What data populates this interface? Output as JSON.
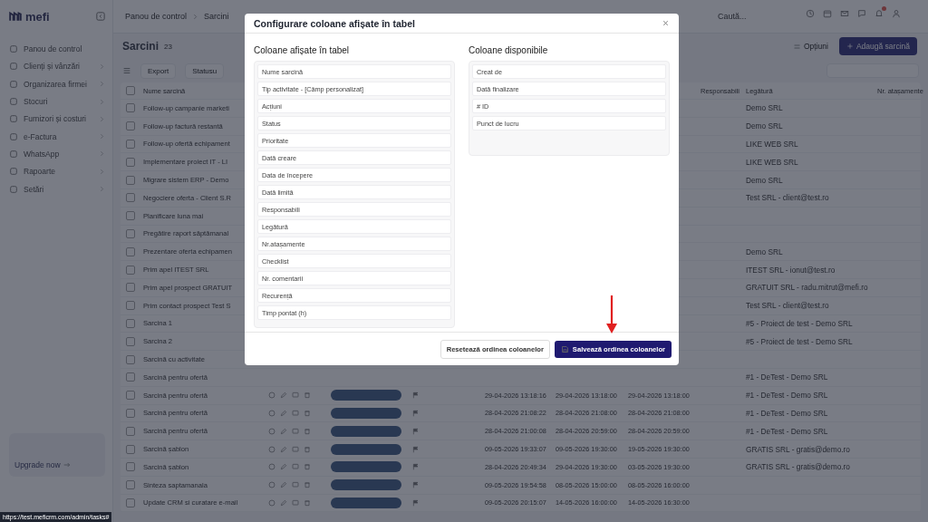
{
  "app": {
    "logo": "mefi",
    "breadcrumb": [
      "Panou de control",
      "Sarcini"
    ],
    "search": {
      "placeholder": "Caută..."
    }
  },
  "sidebar": {
    "items": [
      {
        "label": "Panou de control",
        "submenu": false
      },
      {
        "label": "Clienți și vânzări",
        "submenu": true
      },
      {
        "label": "Organizarea firmei",
        "submenu": true
      },
      {
        "label": "Stocuri",
        "submenu": true
      },
      {
        "label": "Furnizori și costuri",
        "submenu": true
      },
      {
        "label": "e-Factura",
        "submenu": true
      },
      {
        "label": "WhatsApp",
        "submenu": true
      },
      {
        "label": "Rapoarte",
        "submenu": true
      },
      {
        "label": "Setări",
        "submenu": true
      }
    ],
    "upgrade": "Upgrade now"
  },
  "page": {
    "title": "Sarcini",
    "count": "23",
    "options_button": "Opțiuni",
    "add_button": "Adaugă sarcină",
    "toolbar": [
      "Export",
      "Statusu"
    ]
  },
  "table": {
    "columns": [
      "Nume sarcină",
      "Responsabili",
      "Legătură",
      "Nr. atașamente"
    ],
    "select_all_checked": false,
    "rows": [
      {
        "name": "Follow-up campanie marketi",
        "checked": false,
        "link": "Demo SRL"
      },
      {
        "name": "Follow-up factură restantă",
        "checked": false,
        "link": "Demo SRL"
      },
      {
        "name": "Follow-up ofertă echipament",
        "checked": false,
        "link": "LIKE WEB SRL"
      },
      {
        "name": "Implementare proiect IT - LI",
        "checked": false,
        "link": "LIKE WEB SRL"
      },
      {
        "name": "Migrare sistem ERP - Demo",
        "checked": false,
        "link": "Demo SRL"
      },
      {
        "name": "Negociere oferta - Client S.R",
        "checked": false,
        "link": "Test SRL - client@test.ro"
      },
      {
        "name": "Planificare luna mai",
        "checked": false
      },
      {
        "name": "Pregătire raport săptămanal",
        "checked": false
      },
      {
        "name": "Prezentare oferta echipamen",
        "checked": false,
        "link": "Demo SRL"
      },
      {
        "name": "Prim apel ITEST SRL",
        "checked": false,
        "link": "ITEST SRL - ionut@test.ro"
      },
      {
        "name": "Prim apel prospect GRATUIT",
        "checked": false,
        "link": "GRATUIT SRL - radu.mitrut@mefi.ro"
      },
      {
        "name": "Prim contact prospect Test S",
        "checked": false,
        "link": "Test SRL - client@test.ro"
      },
      {
        "name": "Sarcina 1",
        "checked": false,
        "link": "#5 - Proiect de test - Demo SRL"
      },
      {
        "name": "Sarcina 2",
        "checked": false,
        "link": "#5 - Proiect de test - Demo SRL"
      },
      {
        "name": "Sarcină cu activitate",
        "checked": false
      },
      {
        "name": "Sarcină pentru ofertă",
        "checked": false,
        "link": "#1 - DeTest - Demo SRL"
      },
      {
        "name": "Sarcină pentru ofertă",
        "checked": false,
        "link": "#1 - DeTest - Demo SRL",
        "created": "29-04-2026 13:18:16",
        "start": "29-04-2026 13:18:00",
        "deadline": "29-04-2026 13:18:00"
      },
      {
        "name": "Sarcină pentru ofertă",
        "checked": false,
        "link": "#1 - DeTest - Demo SRL",
        "created": "28-04-2026 21:08:22",
        "start": "28-04-2026 21:08:00",
        "deadline": "28-04-2026 21:08:00"
      },
      {
        "name": "Sarcină pentru ofertă",
        "checked": false,
        "link": "#1 - DeTest - Demo SRL",
        "created": "28-04-2026 21:00:08",
        "start": "28-04-2026 20:59:00",
        "deadline": "28-04-2026 20:59:00"
      },
      {
        "name": "Sarcină șablon",
        "checked": false,
        "link": "GRATIS SRL - gratis@demo.ro",
        "created": "09-05-2026 19:33:07",
        "start": "09-05-2026 19:30:00",
        "deadline": "19-05-2026 19:30:00"
      },
      {
        "name": "Sarcină șablon",
        "checked": false,
        "link": "GRATIS SRL - gratis@demo.ro",
        "created": "28-04-2026 20:49:34",
        "start": "29-04-2026 19:30:00",
        "deadline": "03-05-2026 19:30:00"
      },
      {
        "name": "Sinteza saptamanala",
        "checked": false,
        "created": "09-05-2026 19:54:58",
        "start": "08-05-2026 15:00:00",
        "deadline": "08-05-2026 16:00:00"
      },
      {
        "name": "Update CRM si curatare e-mail",
        "checked": false,
        "created": "09-05-2026 20:15:07",
        "start": "14-05-2026 16:00:00",
        "deadline": "14-05-2026 16:30:00"
      }
    ]
  },
  "modal": {
    "title": "Configurare coloane afișate în tabel",
    "shown": {
      "heading": "Coloane afișate în tabel",
      "items": [
        "Nume sarcină",
        "Tip activitate - [Câmp personalizat]",
        "Acțiuni",
        "Status",
        "Prioritate",
        "Dată creare",
        "Data de începere",
        "Dată limită",
        "Responsabili",
        "Legătură",
        "Nr.atașamente",
        "Checklist",
        "Nr. comentarii",
        "Recurență",
        "Timp pontat (h)"
      ]
    },
    "available": {
      "heading": "Coloane disponibile",
      "items": [
        "Creat de",
        "Dată finalizare",
        "# ID",
        "Punct de lucru"
      ]
    },
    "reset_button": "Resetează ordinea coloanelor",
    "save_button": "Salvează ordinea coloanelor"
  },
  "status_bar": {
    "url": "https://test.meficrm.com/admin/tasks#"
  }
}
